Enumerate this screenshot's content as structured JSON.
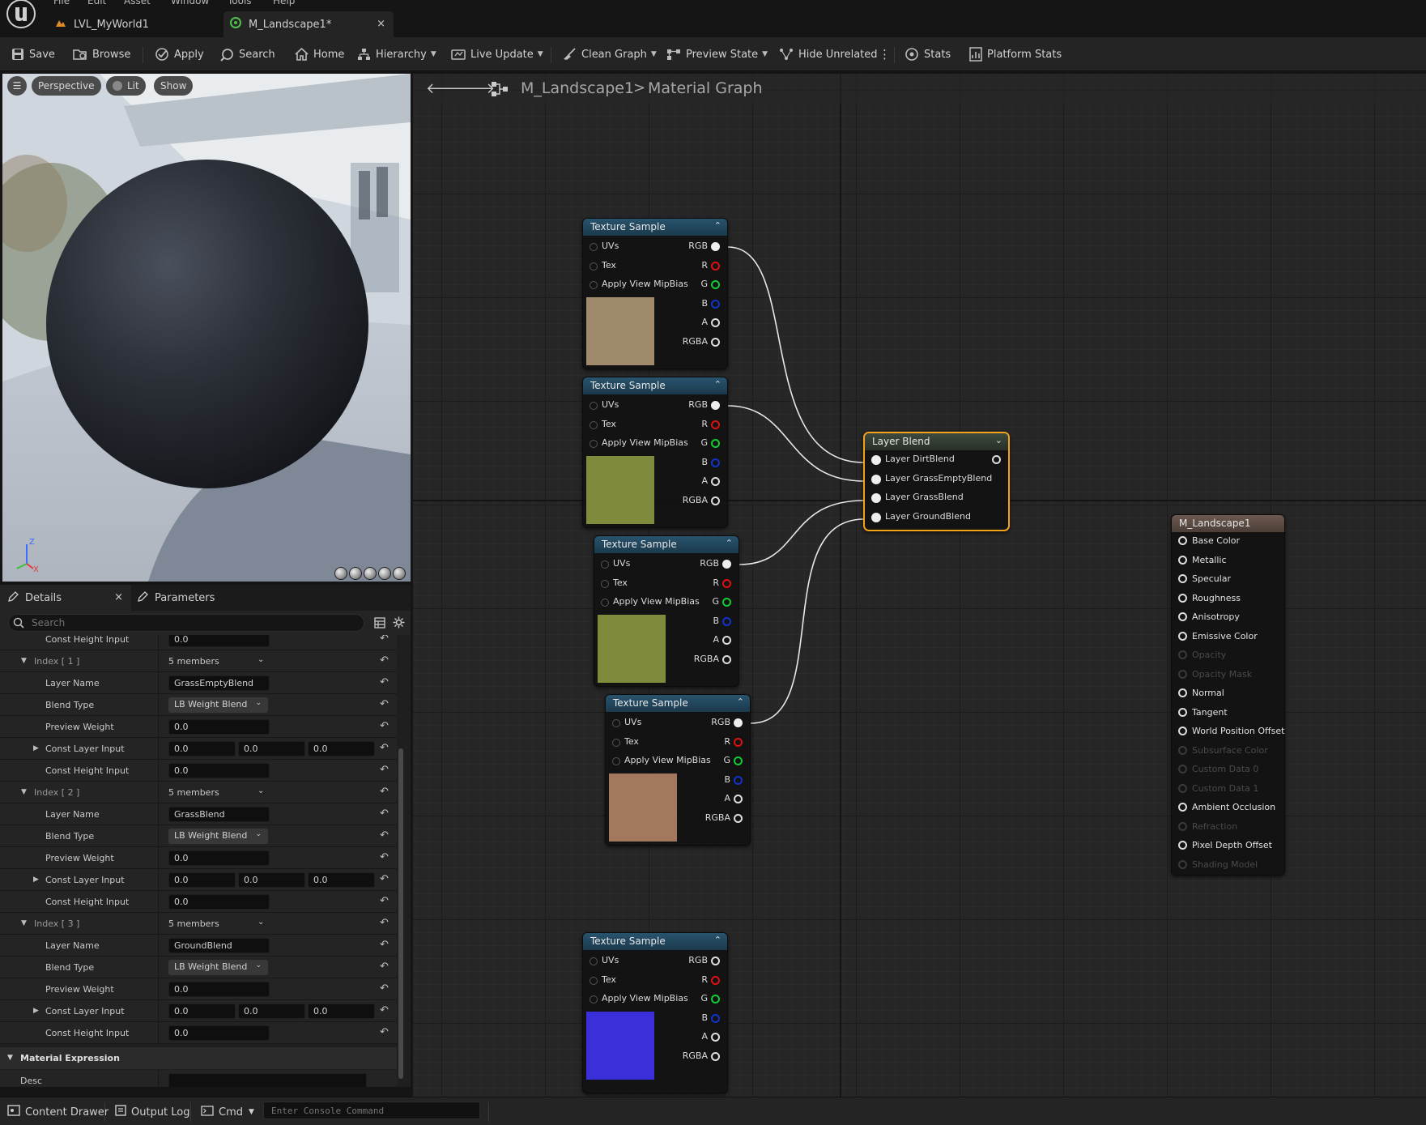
{
  "menu": [
    "File",
    "Edit",
    "Asset",
    "Window",
    "Tools",
    "Help"
  ],
  "tabs": {
    "level": "LVL_MyWorld1",
    "material": "M_Landscape1*",
    "close": "×"
  },
  "toolbar": {
    "save": "Save",
    "browse": "Browse",
    "apply": "Apply",
    "search": "Search",
    "home": "Home",
    "hierarchy": "Hierarchy",
    "live_update": "Live Update",
    "clean_graph": "Clean Graph",
    "preview_state": "Preview State",
    "hide_unrelated": "Hide Unrelated",
    "stats": "Stats",
    "platform_stats": "Platform Stats"
  },
  "viewport": {
    "perspective": "Perspective",
    "lit": "Lit",
    "show": "Show",
    "axis_z": "Z",
    "axis_x": "X"
  },
  "details": {
    "tab_details": "Details",
    "tab_parameters": "Parameters",
    "close": "×",
    "search_placeholder": "Search",
    "rows": [
      {
        "type": "field",
        "label": "Const Height Input",
        "value": "0.0"
      },
      {
        "type": "index",
        "label": "Index [ 1 ]",
        "value": "5 members"
      },
      {
        "type": "field",
        "label": "Layer Name",
        "value": "GrassEmptyBlend"
      },
      {
        "type": "combo",
        "label": "Blend Type",
        "value": "LB Weight Blend"
      },
      {
        "type": "field",
        "label": "Preview Weight",
        "value": "0.0"
      },
      {
        "type": "vec",
        "label": "Const Layer Input",
        "values": [
          "0.0",
          "0.0",
          "0.0"
        ]
      },
      {
        "type": "field",
        "label": "Const Height Input",
        "value": "0.0"
      },
      {
        "type": "index",
        "label": "Index [ 2 ]",
        "value": "5 members"
      },
      {
        "type": "field",
        "label": "Layer Name",
        "value": "GrassBlend"
      },
      {
        "type": "combo",
        "label": "Blend Type",
        "value": "LB Weight Blend"
      },
      {
        "type": "field",
        "label": "Preview Weight",
        "value": "0.0"
      },
      {
        "type": "vec",
        "label": "Const Layer Input",
        "values": [
          "0.0",
          "0.0",
          "0.0"
        ]
      },
      {
        "type": "field",
        "label": "Const Height Input",
        "value": "0.0"
      },
      {
        "type": "index",
        "label": "Index [ 3 ]",
        "value": "5 members"
      },
      {
        "type": "field",
        "label": "Layer Name",
        "value": "GroundBlend"
      },
      {
        "type": "combo",
        "label": "Blend Type",
        "value": "LB Weight Blend"
      },
      {
        "type": "field",
        "label": "Preview Weight",
        "value": "0.0"
      },
      {
        "type": "vec",
        "label": "Const Layer Input",
        "values": [
          "0.0",
          "0.0",
          "0.0"
        ]
      },
      {
        "type": "field",
        "label": "Const Height Input",
        "value": "0.0"
      }
    ],
    "section_material_expression": "Material Expression",
    "desc_label": "Desc",
    "desc_value": ""
  },
  "statusbar": {
    "content_drawer": "Content Drawer",
    "output_log": "Output Log",
    "cmd": "Cmd",
    "console_placeholder": "Enter Console Command"
  },
  "graph": {
    "breadcrumb_root": "M_Landscape1",
    "breadcrumb_sep": ">",
    "breadcrumb_leaf": "Material Graph",
    "texture_nodes": [
      {
        "title": "Texture Sample",
        "thumb": "#a08a6c"
      },
      {
        "title": "Texture Sample",
        "thumb": "#7f8a3c"
      },
      {
        "title": "Texture Sample",
        "thumb": "#7f8a3c"
      },
      {
        "title": "Texture Sample",
        "thumb": "#a3785e"
      },
      {
        "title": "Texture Sample",
        "thumb": "#3a2fd8"
      }
    ],
    "texture_inputs": [
      "UVs",
      "Tex",
      "Apply View MipBias"
    ],
    "texture_outputs": [
      "RGB",
      "R",
      "G",
      "B",
      "A",
      "RGBA"
    ],
    "layer_blend": {
      "title": "Layer Blend",
      "inputs": [
        "Layer DirtBlend",
        "Layer GrassEmptyBlend",
        "Layer GrassBlend",
        "Layer GroundBlend"
      ]
    },
    "result": {
      "title": "M_Landscape1",
      "pins": [
        {
          "label": "Base Color",
          "enabled": true
        },
        {
          "label": "Metallic",
          "enabled": true
        },
        {
          "label": "Specular",
          "enabled": true
        },
        {
          "label": "Roughness",
          "enabled": true
        },
        {
          "label": "Anisotropy",
          "enabled": true
        },
        {
          "label": "Emissive Color",
          "enabled": true
        },
        {
          "label": "Opacity",
          "enabled": false
        },
        {
          "label": "Opacity Mask",
          "enabled": false
        },
        {
          "label": "Normal",
          "enabled": true
        },
        {
          "label": "Tangent",
          "enabled": true
        },
        {
          "label": "World Position Offset",
          "enabled": true
        },
        {
          "label": "Subsurface Color",
          "enabled": false
        },
        {
          "label": "Custom Data 0",
          "enabled": false
        },
        {
          "label": "Custom Data 1",
          "enabled": false
        },
        {
          "label": "Ambient Occlusion",
          "enabled": true
        },
        {
          "label": "Refraction",
          "enabled": false
        },
        {
          "label": "Pixel Depth Offset",
          "enabled": true
        },
        {
          "label": "Shading Model",
          "enabled": false
        }
      ]
    },
    "accent_selected": "#f4a21a"
  }
}
